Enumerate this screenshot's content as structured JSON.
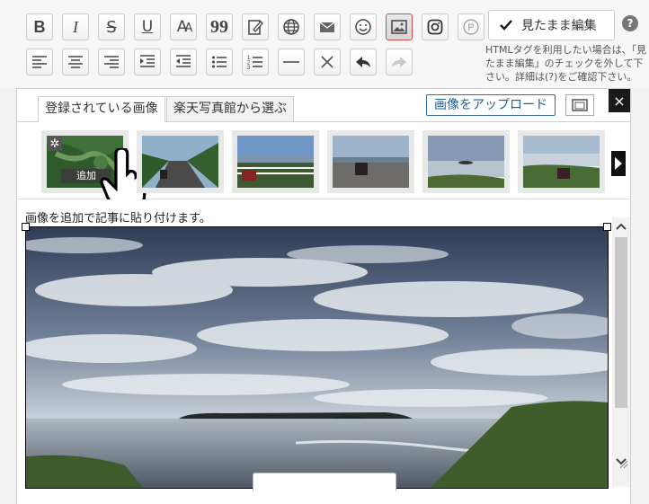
{
  "toolbar": {
    "row1": [
      {
        "name": "bold-button",
        "icon": "bold-icon",
        "glyph": "B"
      },
      {
        "name": "italic-button",
        "icon": "italic-icon",
        "glyph": "I"
      },
      {
        "name": "strikethrough-button",
        "icon": "strikethrough-icon",
        "glyph": "S"
      },
      {
        "name": "underline-button",
        "icon": "underline-icon",
        "glyph": "U"
      },
      {
        "name": "font-size-button",
        "icon": "font-size-icon",
        "glyph": "AA"
      },
      {
        "name": "quote-button",
        "icon": "quote-icon",
        "glyph": "99"
      },
      {
        "name": "edit-note-button",
        "icon": "edit-note-icon",
        "glyph": ""
      },
      {
        "name": "link-button",
        "icon": "globe-icon",
        "glyph": ""
      },
      {
        "name": "mail-button",
        "icon": "mail-icon",
        "glyph": ""
      },
      {
        "name": "emoji-button",
        "icon": "smiley-icon",
        "glyph": ""
      },
      {
        "name": "image-button",
        "icon": "image-icon",
        "glyph": ""
      },
      {
        "name": "instagram-button",
        "icon": "instagram-icon",
        "glyph": ""
      },
      {
        "name": "pinterest-button",
        "icon": "pinterest-icon",
        "glyph": "P"
      }
    ],
    "row2": [
      {
        "name": "align-left-button",
        "icon": "align-left-icon"
      },
      {
        "name": "align-center-button",
        "icon": "align-center-icon"
      },
      {
        "name": "align-right-button",
        "icon": "align-right-icon"
      },
      {
        "name": "indent-button",
        "icon": "indent-icon"
      },
      {
        "name": "outdent-button",
        "icon": "outdent-icon"
      },
      {
        "name": "bullet-list-button",
        "icon": "bullet-list-icon"
      },
      {
        "name": "numbered-list-button",
        "icon": "numbered-list-icon"
      },
      {
        "name": "horizontal-rule-button",
        "icon": "horizontal-rule-icon"
      },
      {
        "name": "clear-format-button",
        "icon": "x-icon"
      },
      {
        "name": "undo-button",
        "icon": "undo-icon"
      },
      {
        "name": "redo-button",
        "icon": "redo-icon"
      }
    ],
    "wysiwyg_label": "見たまま編集",
    "wysiwyg_checked": true,
    "help_glyph": "?",
    "note": "HTMLタグを利用したい場合は、「見たまま編集」のチェックを外して下さい。詳細は(?)をご確認下さい。"
  },
  "image_panel": {
    "tabs": [
      {
        "label": "登録されている画像",
        "active": true
      },
      {
        "label": "楽天写真館から選ぶ",
        "active": false
      }
    ],
    "upload_label": "画像をアップロード",
    "close_glyph": "×",
    "thumbnails": [
      {
        "name": "thumbnail-forest-island",
        "scene": "green-forest",
        "add_label": "追加"
      },
      {
        "name": "thumbnail-road-motorbike",
        "scene": "road"
      },
      {
        "name": "thumbnail-fence-motorbike",
        "scene": "fence"
      },
      {
        "name": "thumbnail-parking-motorbike",
        "scene": "parking"
      },
      {
        "name": "thumbnail-sea-cliff",
        "scene": "sea"
      },
      {
        "name": "thumbnail-coast-motorbike",
        "scene": "coast"
      }
    ]
  },
  "editor": {
    "hint": "画像を追加で記事に貼り付けます。",
    "photo": "cloudy-sky-sea-island"
  },
  "colors": {
    "accent_blue": "#1d5f9c",
    "active_border": "#d34b4b"
  }
}
